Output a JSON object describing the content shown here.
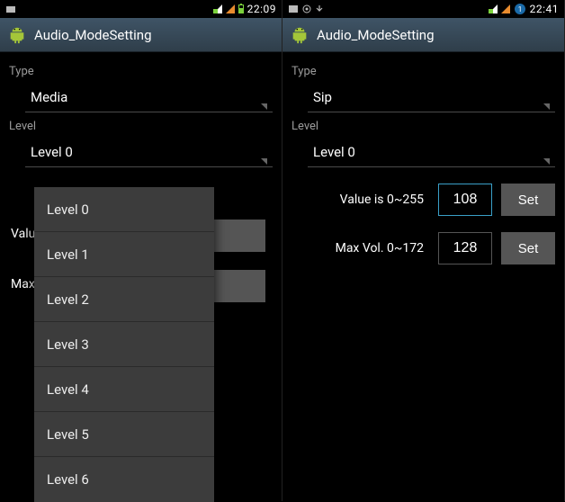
{
  "left": {
    "statusbar": {
      "clock": "22:09"
    },
    "title": "Audio_ModeSetting",
    "type_label": "Type",
    "type_value": "Media",
    "level_label": "Level",
    "level_value": "Level 0",
    "value_prefix": "Valu",
    "max_prefix": "Max ",
    "dropdown": {
      "items": [
        {
          "label": "Level 0"
        },
        {
          "label": "Level 1"
        },
        {
          "label": "Level 2"
        },
        {
          "label": "Level 3"
        },
        {
          "label": "Level 4"
        },
        {
          "label": "Level 5"
        },
        {
          "label": "Level 6"
        }
      ]
    }
  },
  "right": {
    "statusbar": {
      "clock": "22:41"
    },
    "title": "Audio_ModeSetting",
    "type_label": "Type",
    "type_value": "Sip",
    "level_label": "Level",
    "level_value": "Level 0",
    "value_row": {
      "label": "Value is 0~255",
      "value": "108",
      "button": "Set"
    },
    "max_row": {
      "label": "Max Vol. 0~172",
      "value": "128",
      "button": "Set"
    }
  }
}
